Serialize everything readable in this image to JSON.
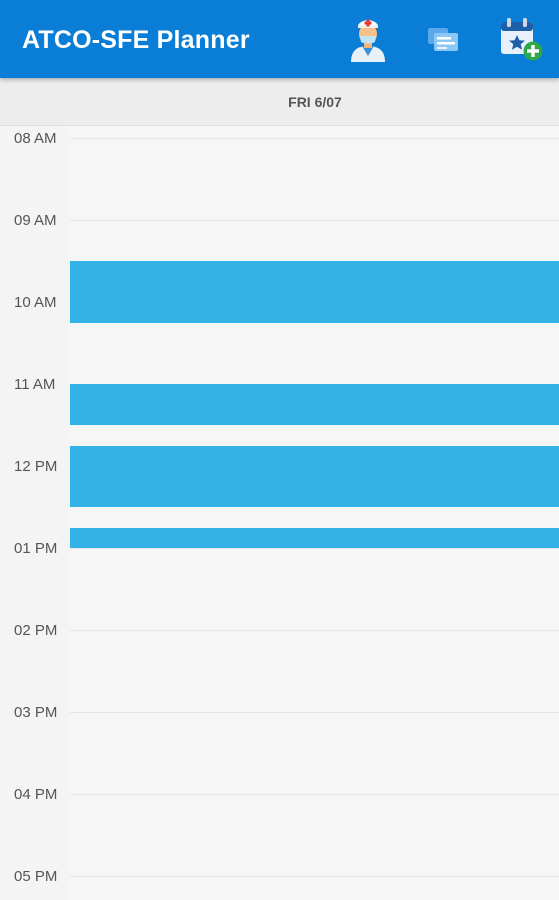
{
  "appbar": {
    "title": "ATCO-SFE Planner",
    "icons": [
      "doctor-icon",
      "cards-icon",
      "calendar-add-icon"
    ],
    "color": "#0a7ed6"
  },
  "day_header": {
    "label": "FRI 6/07"
  },
  "hours": [
    "08 AM",
    "09 AM",
    "10 AM",
    "11 AM",
    "12 PM",
    "01 PM",
    "02 PM",
    "03 PM",
    "04 PM",
    "05 PM"
  ],
  "events": [
    {
      "start": "09:30",
      "end": "10:15"
    },
    {
      "start": "11:00",
      "end": "11:30"
    },
    {
      "start": "11:45",
      "end": "12:30"
    },
    {
      "start": "12:45",
      "end": "13:00"
    }
  ],
  "colors": {
    "event": "#33b2e6",
    "background": "#f6f6f6"
  }
}
